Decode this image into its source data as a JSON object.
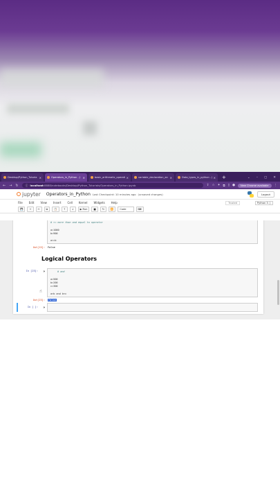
{
  "browser": {
    "tabs": [
      {
        "title": "Desktop/Python_Tutoria",
        "active": false
      },
      {
        "title": "Operators_in_Python - J",
        "active": true
      },
      {
        "title": "basic_arithmatic_operati",
        "active": false
      },
      {
        "title": "variable_declaration_an",
        "active": false
      },
      {
        "title": "Data_types_in_python - J",
        "active": false
      }
    ],
    "new_tab": "+",
    "window_controls": [
      "⌄",
      "–",
      "▢",
      "✕"
    ],
    "url_host": "localhost",
    "url_rest": ":8888/notebooks/Desktop/Python_Tutorials/Operators_in_Python.ipynb",
    "update_button": "New Chrome available"
  },
  "jupyter": {
    "logo": "jupyter",
    "notebook_title": "Operators_in_Python",
    "checkpoint": "Last Checkpoint: 10 minutes ago",
    "unsaved": "(unsaved changes)",
    "logout": "Logout",
    "menu": [
      "File",
      "Edit",
      "View",
      "Insert",
      "Cell",
      "Kernel",
      "Widgets",
      "Help"
    ],
    "trusted": "Trusted",
    "kernel": "Python 3 ○",
    "toolbar": {
      "run": "▶ Run",
      "cell_type": "Code",
      "icons": [
        "💾",
        "+",
        "✂",
        "⧉",
        "📋",
        "↑",
        "↓"
      ]
    }
  },
  "notebook": {
    "cell1": {
      "comment": "# >= more than and equal to operator",
      "line1": "a=1000",
      "line2": "b=900",
      "line3": "a<=b",
      "out_prompt": "Out[15]:",
      "output": "False"
    },
    "heading": "Logical Operators",
    "cell2": {
      "in_prompt": "In [23]:",
      "comment": "# and",
      "line1": "a=500",
      "line2": "b=200",
      "line3": "c=300",
      "line4": "a>b and b<c",
      "out_prompt": "Out[23]:",
      "output": "False"
    },
    "cell3": {
      "in_prompt": "In [ ]:"
    }
  }
}
